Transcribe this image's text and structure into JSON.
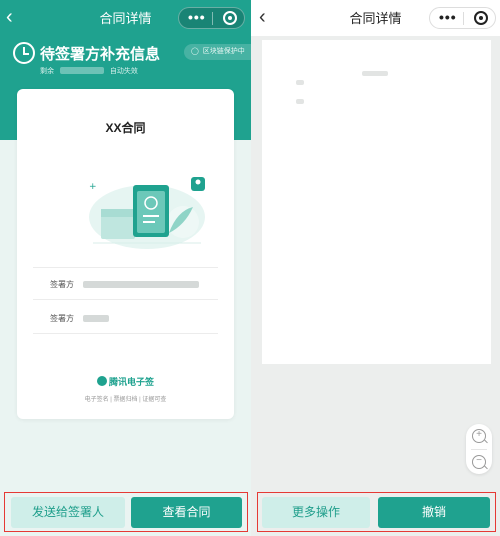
{
  "left": {
    "nav_title": "合同详情",
    "capsule_dots": "•••",
    "status": {
      "title": "待签署方补充信息",
      "remaining_prefix": "剩余",
      "remaining_suffix": "自动失效",
      "badge": "区块链保护中",
      "badge_icon": "shield-icon"
    },
    "card": {
      "title": "XX合同",
      "parties": [
        {
          "label": "签署方"
        },
        {
          "label": "签署方"
        }
      ],
      "brand": "腾讯电子签",
      "tagline": "电子签名 | 票据归档 | 证据可查"
    },
    "buttons": {
      "send": "发送给签署人",
      "view": "查看合同"
    },
    "colors": {
      "teal": "#1fa28f",
      "light_teal": "#cfeee9",
      "highlight_border": "#e53935"
    }
  },
  "right": {
    "nav_title": "合同详情",
    "capsule_dots": "•••",
    "zoom": {
      "in_symbol": "+",
      "out_symbol": "−"
    },
    "buttons": {
      "more": "更多操作",
      "revoke": "撤销"
    }
  }
}
